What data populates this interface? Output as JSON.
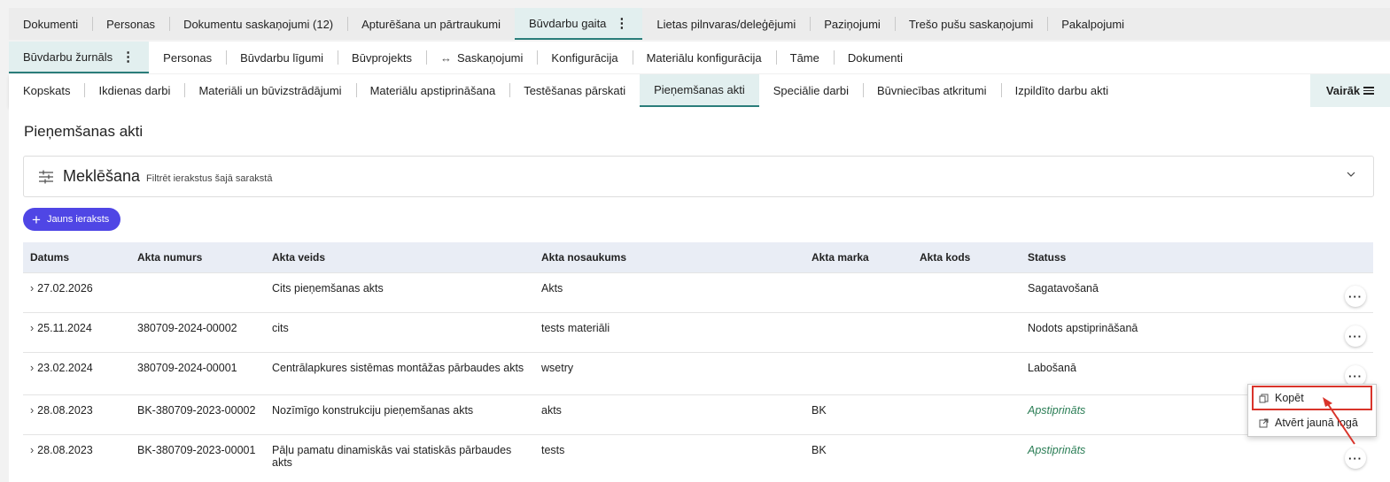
{
  "nav": {
    "row1": [
      "Dokumenti",
      "Personas",
      "Dokumentu saskaņojumi (12)",
      "Apturēšana un pārtraukumi",
      "Būvdarbu gaita",
      "Lietas pilnvaras/deleģējumi",
      "Paziņojumi",
      "Trešo pušu saskaņojumi",
      "Pakalpojumi"
    ],
    "row1_active": "Būvdarbu gaita",
    "row2": [
      "Būvdarbu žurnāls",
      "Personas",
      "Būvdarbu līgumi",
      "Būvprojekts",
      "Saskaņojumi",
      "Konfigurācija",
      "Materiālu konfigurācija",
      "Tāme",
      "Dokumenti"
    ],
    "row2_active": "Būvdarbu žurnāls",
    "row3": [
      "Kopskats",
      "Ikdienas darbi",
      "Materiāli un būvizstrādājumi",
      "Materiālu apstiprināšana",
      "Testēšanas pārskati",
      "Pieņemšanas akti",
      "Speciālie darbi",
      "Būvniecības atkritumi",
      "Izpildīto darbu akti"
    ],
    "row3_active": "Pieņemšanas akti",
    "more_label": "Vairāk"
  },
  "page_title": "Pieņemšanas akti",
  "search": {
    "title": "Meklēšana",
    "subtitle": "Filtrēt ierakstus šajā sarakstā"
  },
  "new_button": "Jauns ieraksts",
  "table": {
    "headers": [
      "Datums",
      "Akta numurs",
      "Akta veids",
      "Akta nosaukums",
      "Akta marka",
      "Akta kods",
      "Statuss"
    ],
    "rows": [
      {
        "date": "27.02.2026",
        "number": "",
        "type": "Cits pieņemšanas akts",
        "name": "Akts",
        "mark": "",
        "code": "",
        "status": "Sagatavošanā"
      },
      {
        "date": "25.11.2024",
        "number": "380709-2024-00002",
        "type": "cits",
        "name": "tests materiāli",
        "mark": "",
        "code": "",
        "status": "Nodots apstiprināšanā"
      },
      {
        "date": "23.02.2024",
        "number": "380709-2024-00001",
        "type": "Centrālapkures sistēmas montāžas pārbaudes akts",
        "name": "wsetry",
        "mark": "",
        "code": "",
        "status": "Labošanā"
      },
      {
        "date": "28.08.2023",
        "number": "BK-380709-2023-00002",
        "type": "Nozīmīgo konstrukciju pieņemšanas akts",
        "name": "akts",
        "mark": "BK",
        "code": "",
        "status": "Apstiprināts"
      },
      {
        "date": "28.08.2023",
        "number": "BK-380709-2023-00001",
        "type": "Pāļu pamatu dinamiskās vai statiskās pārbaudes akts",
        "name": "tests",
        "mark": "BK",
        "code": "",
        "status": "Apstiprināts"
      }
    ]
  },
  "context_menu": {
    "copy": "Kopēt",
    "open_new": "Atvērt jaunā logā"
  },
  "colors": {
    "accent": "#2a7d7a",
    "primary_button": "#4f46e5",
    "approved": "#2a7d55",
    "highlight": "#d9342b"
  }
}
